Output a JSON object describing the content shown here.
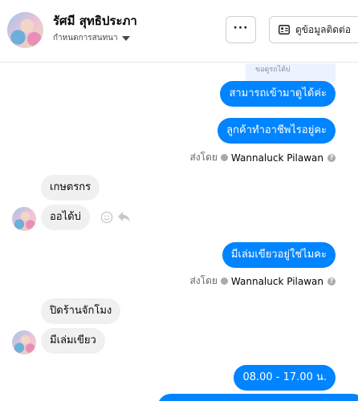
{
  "header": {
    "contact_name": "รัศมี สุทธิประภา",
    "conversation_label": "กำหนดการสนทนา",
    "more_label": "···",
    "contact_info_label": "ดูข้อมูลติดต่อ"
  },
  "messages": {
    "prev_snippet": "ขอดูรถได้บ่",
    "out_1": "สามารถเข้ามาดูได้ค่ะ",
    "out_2": "ลูกค้าทำอาชีพไรอยู่คะ",
    "sent_by_prefix": "ส่งโดย",
    "sent_by_name": "Wannaluck Pilawan",
    "in_1": "เกษตรกร",
    "in_2": "ออได้บ่",
    "out_3": "มีเล่มเขียวอยู่ใช่ไมคะ",
    "in_3": "ปิดร้านจักโมง",
    "in_4": "มีเล่มเขียว",
    "out_4": "08.00 - 17.00  น."
  },
  "colors": {
    "outgoing_bubble": "#0084ff",
    "incoming_bubble": "#f0f0f0"
  }
}
